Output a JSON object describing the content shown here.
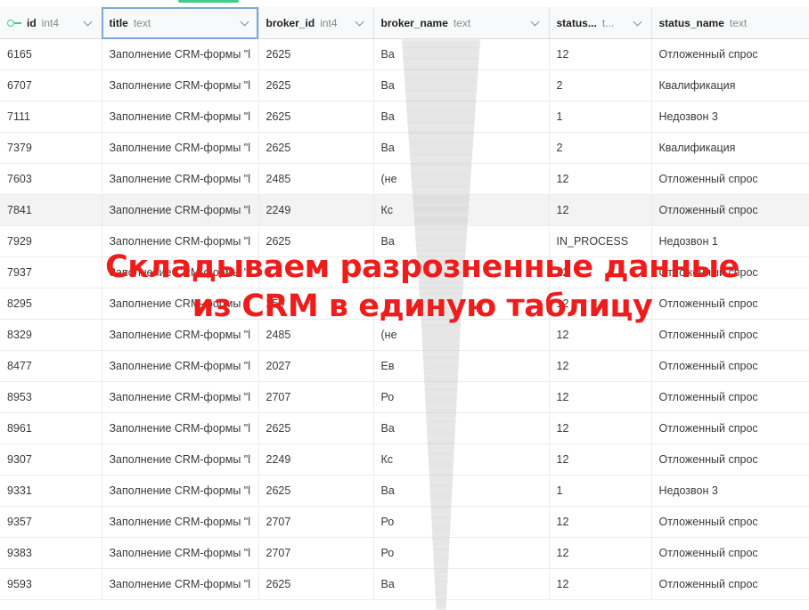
{
  "columns": [
    {
      "name": "id",
      "type": "int4"
    },
    {
      "name": "title",
      "type": "text"
    },
    {
      "name": "broker_id",
      "type": "int4"
    },
    {
      "name": "broker_name",
      "type": "text"
    },
    {
      "name": "status...",
      "type": "t..."
    },
    {
      "name": "status_name",
      "type": "text"
    }
  ],
  "rows": [
    {
      "id": "6165",
      "title": "Заполнение CRM-формы \"l",
      "broker_id": "2625",
      "broker_name": "Ва",
      "status": "12",
      "status_name": "Отложенный спрос"
    },
    {
      "id": "6707",
      "title": "Заполнение CRM-формы \"l",
      "broker_id": "2625",
      "broker_name": "Ва",
      "status": "2",
      "status_name": "Квалификация"
    },
    {
      "id": "7111",
      "title": "Заполнение CRM-формы \"l",
      "broker_id": "2625",
      "broker_name": "Ва",
      "status": "1",
      "status_name": "Недозвон 3"
    },
    {
      "id": "7379",
      "title": "Заполнение CRM-формы \"l",
      "broker_id": "2625",
      "broker_name": "Ва",
      "status": "2",
      "status_name": "Квалификация"
    },
    {
      "id": "7603",
      "title": "Заполнение CRM-формы \"l",
      "broker_id": "2485",
      "broker_name": "(не",
      "status": "12",
      "status_name": "Отложенный спрос"
    },
    {
      "id": "7841",
      "title": "Заполнение CRM-формы \"l",
      "broker_id": "2249",
      "broker_name": "Кс",
      "status": "12",
      "status_name": "Отложенный спрос"
    },
    {
      "id": "7929",
      "title": "Заполнение CRM-формы \"l",
      "broker_id": "2625",
      "broker_name": "Ва",
      "status": "IN_PROCESS",
      "status_name": "Недозвон 1"
    },
    {
      "id": "7937",
      "title": "Заполнение CRM-формы \"l",
      "broker_id": "2",
      "broker_name": "",
      "status": "12",
      "status_name": "Отложенный спрос"
    },
    {
      "id": "8295",
      "title": "Заполнение CRM-формы \"l",
      "broker_id": "250",
      "broker_name": "",
      "status": "12",
      "status_name": "Отложенный спрос"
    },
    {
      "id": "8329",
      "title": "Заполнение CRM-формы \"l",
      "broker_id": "2485",
      "broker_name": "(не",
      "status": "12",
      "status_name": "Отложенный спрос"
    },
    {
      "id": "8477",
      "title": "Заполнение CRM-формы \"l",
      "broker_id": "2027",
      "broker_name": "Ев",
      "status": "12",
      "status_name": "Отложенный спрос"
    },
    {
      "id": "8953",
      "title": "Заполнение CRM-формы \"l",
      "broker_id": "2707",
      "broker_name": "Ро",
      "status": "12",
      "status_name": "Отложенный спрос"
    },
    {
      "id": "8961",
      "title": "Заполнение CRM-формы \"l",
      "broker_id": "2625",
      "broker_name": "Ва",
      "status": "12",
      "status_name": "Отложенный спрос"
    },
    {
      "id": "9307",
      "title": "Заполнение CRM-формы \"l",
      "broker_id": "2249",
      "broker_name": "Кс",
      "status": "12",
      "status_name": "Отложенный спрос"
    },
    {
      "id": "9331",
      "title": "Заполнение CRM-формы \"l",
      "broker_id": "2625",
      "broker_name": "Ва",
      "status": "1",
      "status_name": "Недозвон 3"
    },
    {
      "id": "9357",
      "title": "Заполнение CRM-формы \"l",
      "broker_id": "2707",
      "broker_name": "Ро",
      "status": "12",
      "status_name": "Отложенный спрос"
    },
    {
      "id": "9383",
      "title": "Заполнение CRM-формы \"l",
      "broker_id": "2707",
      "broker_name": "Ро",
      "status": "12",
      "status_name": "Отложенный спрос"
    },
    {
      "id": "9593",
      "title": "Заполнение CRM-формы \"l",
      "broker_id": "2625",
      "broker_name": "Ва",
      "status": "12",
      "status_name": "Отложенный спрос"
    }
  ],
  "overlay": {
    "line1": "Складываем разрозненные данные",
    "line2": "из CRM в единую таблицу"
  },
  "colors": {
    "overlay_text": "#ef1c1c",
    "accent": "#3ecf8e",
    "selected_outline": "#7ea7d8"
  }
}
